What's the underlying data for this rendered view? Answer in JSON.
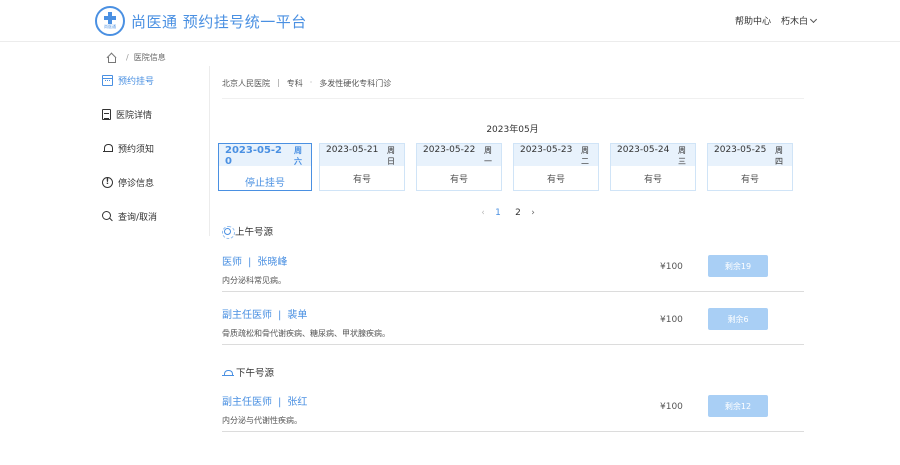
{
  "header": {
    "logo_text": "尚医通",
    "site_title": "尚医通 预约挂号统一平台",
    "help_label": "帮助中心",
    "user_name": "朽木白"
  },
  "breadcrumb": {
    "label": "医院信息"
  },
  "sidebar": {
    "items": [
      {
        "label": "预约挂号"
      },
      {
        "label": "医院详情"
      },
      {
        "label": "预约须知"
      },
      {
        "label": "停诊信息"
      },
      {
        "label": "查询/取消"
      }
    ]
  },
  "dept_path": {
    "hospital": "北京人民医院",
    "sep1": "|",
    "dept": "专科",
    "sep2": "·",
    "clinic": "多发性硬化专科门诊"
  },
  "calendar": {
    "month": "2023年05月",
    "dates": [
      {
        "date": "2023-05-20",
        "week": "周六",
        "status": "停止挂号"
      },
      {
        "date": "2023-05-21",
        "week": "周日",
        "status": "有号"
      },
      {
        "date": "2023-05-22",
        "week": "周一",
        "status": "有号"
      },
      {
        "date": "2023-05-23",
        "week": "周二",
        "status": "有号"
      },
      {
        "date": "2023-05-24",
        "week": "周三",
        "status": "有号"
      },
      {
        "date": "2023-05-25",
        "week": "周四",
        "status": "有号"
      }
    ]
  },
  "pager": {
    "prev": "‹",
    "pages": [
      "1",
      "2"
    ],
    "next": "›"
  },
  "morning": {
    "title": "上午号源",
    "doctors": [
      {
        "title": "医师",
        "name": "张晓峰",
        "desc": "内分泌科常见病。",
        "price": "¥100",
        "remain": "剩余19"
      },
      {
        "title": "副主任医师",
        "name": "裴单",
        "desc": "骨质疏松和骨代谢疾病、糖尿病、甲状腺疾病。",
        "price": "¥100",
        "remain": "剩余6"
      }
    ]
  },
  "afternoon": {
    "title": "下午号源",
    "doctors": [
      {
        "title": "副主任医师",
        "name": "张红",
        "desc": "内分泌与代谢性疾病。",
        "price": "¥100",
        "remain": "剩余12"
      }
    ]
  },
  "colors": {
    "accent": "#4a90e2",
    "button": "#a9cff5"
  }
}
